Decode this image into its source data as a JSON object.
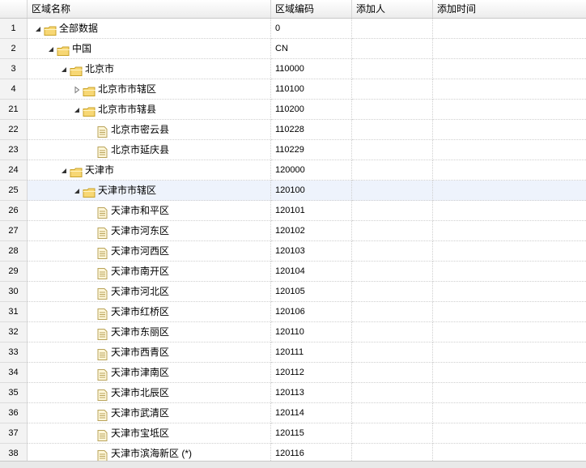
{
  "header": {
    "name_col": "区域名称",
    "code_col": "区域编码",
    "user_col": "添加人",
    "time_col": "添加时间"
  },
  "rows": [
    {
      "num": "1",
      "label": "全部数据",
      "code": "0",
      "level": 0,
      "node": "folder",
      "toggle": "expanded"
    },
    {
      "num": "2",
      "label": "中国",
      "code": "CN",
      "level": 1,
      "node": "folder",
      "toggle": "expanded"
    },
    {
      "num": "3",
      "label": "北京市",
      "code": "110000",
      "level": 2,
      "node": "folder",
      "toggle": "expanded"
    },
    {
      "num": "4",
      "label": "北京市市辖区",
      "code": "110100",
      "level": 3,
      "node": "folder",
      "toggle": "collapsed"
    },
    {
      "num": "21",
      "label": "北京市市辖县",
      "code": "110200",
      "level": 3,
      "node": "folder",
      "toggle": "expanded"
    },
    {
      "num": "22",
      "label": "北京市密云县",
      "code": "110228",
      "level": 4,
      "node": "file",
      "toggle": "none"
    },
    {
      "num": "23",
      "label": "北京市延庆县",
      "code": "110229",
      "level": 4,
      "node": "file",
      "toggle": "none"
    },
    {
      "num": "24",
      "label": "天津市",
      "code": "120000",
      "level": 2,
      "node": "folder",
      "toggle": "expanded"
    },
    {
      "num": "25",
      "label": "天津市市辖区",
      "code": "120100",
      "level": 3,
      "node": "folder",
      "toggle": "expanded",
      "selected": true
    },
    {
      "num": "26",
      "label": "天津市和平区",
      "code": "120101",
      "level": 4,
      "node": "file",
      "toggle": "none"
    },
    {
      "num": "27",
      "label": "天津市河东区",
      "code": "120102",
      "level": 4,
      "node": "file",
      "toggle": "none"
    },
    {
      "num": "28",
      "label": "天津市河西区",
      "code": "120103",
      "level": 4,
      "node": "file",
      "toggle": "none"
    },
    {
      "num": "29",
      "label": "天津市南开区",
      "code": "120104",
      "level": 4,
      "node": "file",
      "toggle": "none"
    },
    {
      "num": "30",
      "label": "天津市河北区",
      "code": "120105",
      "level": 4,
      "node": "file",
      "toggle": "none"
    },
    {
      "num": "31",
      "label": "天津市红桥区",
      "code": "120106",
      "level": 4,
      "node": "file",
      "toggle": "none"
    },
    {
      "num": "32",
      "label": "天津市东丽区",
      "code": "120110",
      "level": 4,
      "node": "file",
      "toggle": "none"
    },
    {
      "num": "33",
      "label": "天津市西青区",
      "code": "120111",
      "level": 4,
      "node": "file",
      "toggle": "none"
    },
    {
      "num": "34",
      "label": "天津市津南区",
      "code": "120112",
      "level": 4,
      "node": "file",
      "toggle": "none"
    },
    {
      "num": "35",
      "label": "天津市北辰区",
      "code": "120113",
      "level": 4,
      "node": "file",
      "toggle": "none"
    },
    {
      "num": "36",
      "label": "天津市武清区",
      "code": "120114",
      "level": 4,
      "node": "file",
      "toggle": "none"
    },
    {
      "num": "37",
      "label": "天津市宝坻区",
      "code": "120115",
      "level": 4,
      "node": "file",
      "toggle": "none"
    },
    {
      "num": "38",
      "label": "天津市滨海新区 (*)",
      "code": "120116",
      "level": 4,
      "node": "file",
      "toggle": "none"
    }
  ]
}
